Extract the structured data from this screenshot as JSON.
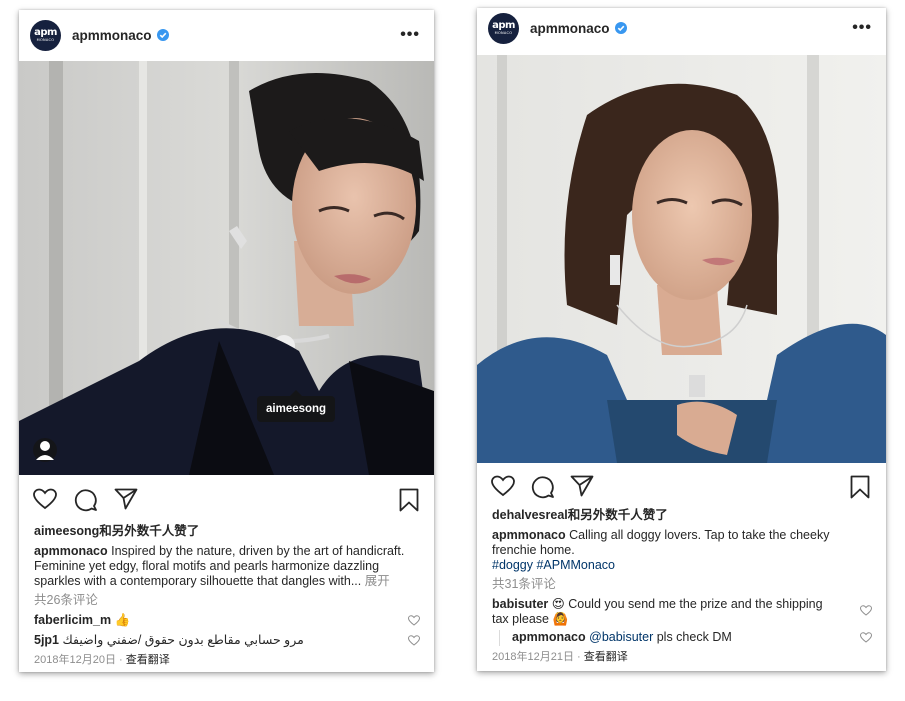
{
  "posts": [
    {
      "account": "apmmonaco",
      "avatar_text": "apm",
      "avatar_subtext": "MONACO",
      "photo_tag": "aimeesong",
      "liked_by": "aimeesong和另外数千人赞了",
      "caption_user": "apmmonaco",
      "caption_text": "Inspired by the nature, driven by the art of handicraft. Feminine yet edgy,  floral motifs and pearls harmonize dazzling sparkles with a contemporary silhouette that dangles with...",
      "expand": "展开",
      "comment_count": "共26条评论",
      "comments": [
        {
          "user": "faberlicim_m",
          "text": "👍"
        },
        {
          "user": "5jp1",
          "text": "مرو حسابي مقاطع بدون حقوق /ضفني واضيفك"
        }
      ],
      "date": "2018年12月20日",
      "translate": "查看翻译"
    },
    {
      "account": "apmmonaco",
      "avatar_text": "apm",
      "avatar_subtext": "MONACO",
      "liked_by": "dehalvesreal和另外数千人赞了",
      "caption_user": "apmmonaco",
      "caption_text": "Calling all doggy lovers. Tap to take the cheeky frenchie home.",
      "hashtags": "#doggy #APMMonaco",
      "comment_count": "共31条评论",
      "comments": [
        {
          "user": "babisuter",
          "text": "😍 Could you send me the prize and the shipping tax please 🙆"
        },
        {
          "user": "apmmonaco",
          "mention": "@babisuter",
          "text": "pls check DM"
        }
      ],
      "date": "2018年12月21日",
      "translate": "查看翻译"
    }
  ],
  "colors": {
    "verified": "#3897f0",
    "avatar_bg": "#16213e",
    "hashtag": "#003569",
    "muted": "#8e8e8e"
  },
  "icons": [
    "verified-icon",
    "more-icon",
    "heart-icon",
    "comment-icon",
    "share-icon",
    "bookmark-icon",
    "user-tag-icon"
  ]
}
